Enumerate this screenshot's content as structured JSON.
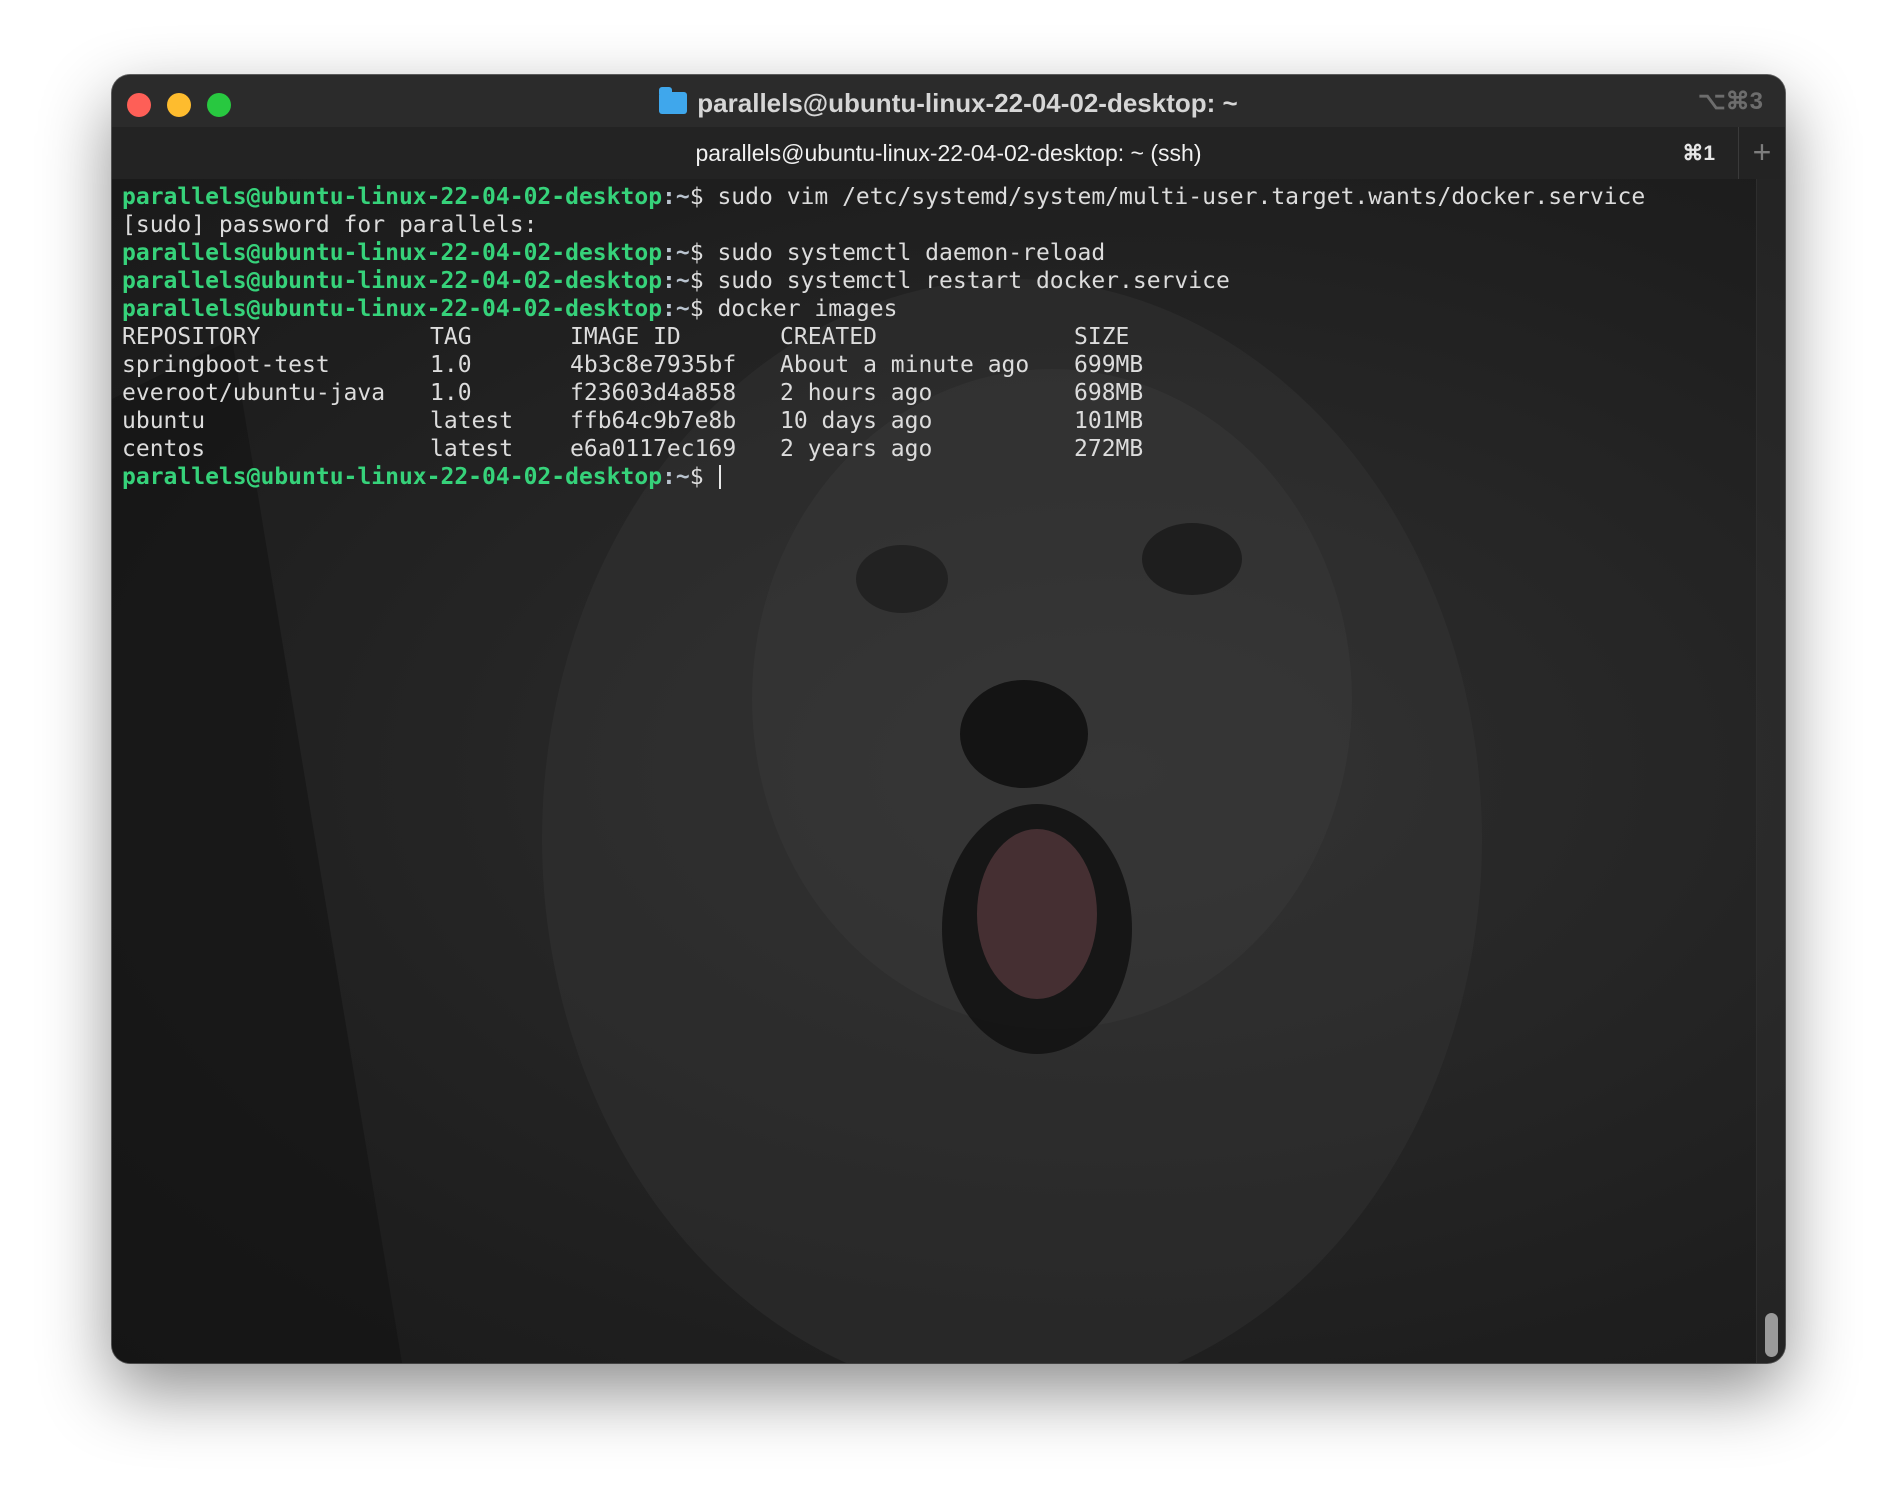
{
  "window": {
    "title": "parallels@ubuntu-linux-22-04-02-desktop: ~",
    "title_shortcut": "⌥⌘3",
    "tab_title": "parallels@ubuntu-linux-22-04-02-desktop: ~ (ssh)",
    "tab_shortcut": "⌘1",
    "new_tab_label": "+"
  },
  "terminal": {
    "prompt_user": "parallels@ubuntu-linux-22-04-02-desktop",
    "prompt_path": ":~",
    "prompt_symbol": "$ ",
    "lines": {
      "cmd1": "sudo vim /etc/systemd/system/multi-user.target.wants/docker.service",
      "sudo_password": "[sudo] password for parallels:",
      "cmd2": "sudo systemctl daemon-reload",
      "cmd3": "sudo systemctl restart docker.service",
      "cmd4": "docker images"
    },
    "table": {
      "headers": [
        "REPOSITORY",
        "TAG",
        "IMAGE ID",
        "CREATED",
        "SIZE"
      ],
      "rows": [
        [
          "springboot-test",
          "1.0",
          "4b3c8e7935bf",
          "About a minute ago",
          "699MB"
        ],
        [
          "everoot/ubuntu-java",
          "1.0",
          "f23603d4a858",
          "2 hours ago",
          "698MB"
        ],
        [
          "ubuntu",
          "latest",
          "ffb64c9b7e8b",
          "10 days ago",
          "101MB"
        ],
        [
          "centos",
          "latest",
          "e6a0117ec169",
          "2 years ago",
          "272MB"
        ]
      ]
    }
  },
  "colors": {
    "prompt_green": "#36d27a",
    "text": "#dcdcdc",
    "close": "#fe5f57",
    "minimize": "#febc2e",
    "zoom": "#28c840"
  }
}
